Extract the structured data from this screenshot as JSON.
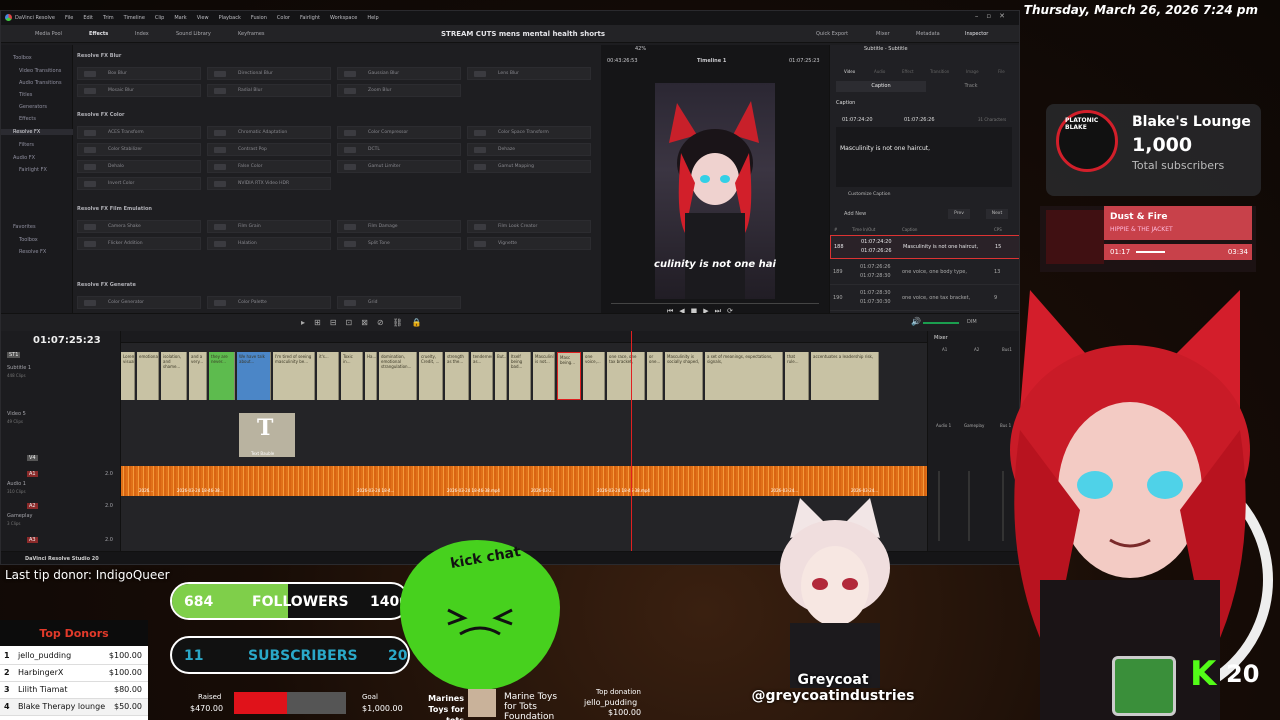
{
  "datetime": "Thursday, March 26, 2026 7:24 pm",
  "resolve": {
    "menu": [
      "DaVinci Resolve",
      "File",
      "Edit",
      "Trim",
      "Timeline",
      "Clip",
      "Mark",
      "View",
      "Playback",
      "Fusion",
      "Color",
      "Fairlight",
      "Workspace",
      "Help"
    ],
    "toolbar": {
      "media_pool": "Media Pool",
      "effects": "Effects",
      "index": "Index",
      "sound_library": "Sound Library",
      "keyframes": "Keyframes",
      "quick_export": "Quick Export",
      "mixer": "Mixer",
      "metadata": "Metadata",
      "inspector": "Inspector"
    },
    "project_title": "STREAM CUTS mens mental health shorts",
    "sidebar": [
      "Toolbox",
      "Video Transitions",
      "Audio Transitions",
      "Titles",
      "Generators",
      "Effects",
      "Resolve FX",
      "Filters",
      "Audio FX",
      "Fairlight FX",
      "Favorites",
      "Toolbox",
      "Resolve FX"
    ],
    "fx_groups": [
      {
        "name": "Resolve FX Blur",
        "items": [
          "Box Blur",
          "Directional Blur",
          "Gaussian Blur",
          "Lens Blur",
          "Mosaic Blur",
          "Radial Blur",
          "Zoom Blur"
        ]
      },
      {
        "name": "Resolve FX Color",
        "items": [
          "ACES Transform",
          "Chromatic Adaptation",
          "Color Compressor",
          "Color Space Transform",
          "Color Stabilizer",
          "Contrast Pop",
          "DCTL",
          "Dehaze",
          "Dehalo",
          "False Color",
          "Gamut Limiter",
          "Gamut Mapping",
          "Invert Color",
          "NVIDIA RTX Video HDR"
        ]
      },
      {
        "name": "Resolve FX Film Emulation",
        "items": [
          "Camera Shake",
          "Film Grain",
          "Film Damage",
          "Film Look Creator",
          "Flicker Addition",
          "Halation",
          "Split Tone",
          "Vignette"
        ]
      },
      {
        "name": "Resolve FX Generate",
        "items": [
          "Color Generator",
          "Color Palette",
          "Grid"
        ]
      }
    ],
    "viewer": {
      "zoom": "42%",
      "timeline_name": "Timeline 1",
      "timecode_left": "00:43:26:53",
      "timecode_right": "01:07:25:23",
      "caption": "culinity is not one hai"
    },
    "inspector": {
      "title": "Subtitle - Subtitle",
      "tabs": [
        "Video",
        "Audio",
        "Effect",
        "Transition",
        "Image",
        "File"
      ],
      "subtabs": [
        "Caption",
        "Track"
      ],
      "section": "Caption",
      "in": "01:07:24:20",
      "out": "01:07:26:26",
      "chars": "31 Characters",
      "text": "Masculinity is not one haircut,",
      "customize": "Customize Caption",
      "add_new": "Add New",
      "prev": "Prev",
      "next": "Next",
      "list_headers": [
        "#",
        "Time In/Out",
        "Caption",
        "CPS"
      ],
      "rows": [
        {
          "num": "188",
          "in": "01:07:24:20",
          "out": "01:07:26:26",
          "text": "Masculinity is not one haircut,",
          "cps": "15"
        },
        {
          "num": "189",
          "in": "01:07:26:26",
          "out": "01:07:28:30",
          "text": "one voice, one body type,",
          "cps": "13"
        },
        {
          "num": "190",
          "in": "01:07:28:30",
          "out": "01:07:30:30",
          "text": "one voice, one tax bracket,",
          "cps": "9"
        }
      ]
    },
    "timeline": {
      "timecode": "01:07:25:23",
      "tracks": [
        {
          "id": "ST1",
          "name": "Subtitle 1",
          "clips": "448 Clips"
        },
        {
          "id": "V5",
          "name": "Video 5",
          "clips": "49 Clips"
        },
        {
          "id": "V4",
          "name": "",
          "clips": ""
        },
        {
          "id": "A1",
          "name": "Audio 1",
          "clips": "310 Clips",
          "level": "2.0"
        },
        {
          "id": "A2",
          "name": "Gameplay",
          "clips": "3 Clips",
          "level": "2.0"
        },
        {
          "id": "A3",
          "name": "",
          "clips": "",
          "level": "2.0"
        }
      ],
      "subtitle_clips": [
        "Lorem visual...",
        "emotional...",
        "isolation, and shame...",
        "and a very...",
        "they are never...",
        "We have talk about...",
        "I'm tired of seeing masculinity be...",
        "it's...",
        "Toxic in...",
        "Ha...",
        "domination, emotional strangulation...",
        "cruelty, Credit, ...",
        "strength as the...",
        "tenderness as...",
        "But...",
        "Itself being bad...",
        "Masculinity is not...",
        "Masc being...",
        "one voice,...",
        "one race, one tax bracket,",
        "or one...",
        "Masculinity is socially shaped,",
        "a set of meanings, expectations, signals,",
        "that rule...",
        "accentuates a leadership risk,"
      ],
      "video_clip_label": "Text Bauble",
      "audio_clip_labels": [
        "2026...",
        "2026-03-24 18-46-38...",
        "2026-03-24 18-4...",
        "2026-03-24 18-46-38.mp4",
        "2026-03-2...",
        "2026-03-24 18-46-38.mp4",
        "2026-03-24...",
        "2026-03-24..."
      ]
    },
    "mixer": {
      "title": "Mixer",
      "channels": [
        "A1",
        "A2",
        "Bus1"
      ],
      "labels": [
        "Audio 1",
        "Gameplay",
        "Bus 1"
      ]
    },
    "status": "DaVinci Resolve Studio 20",
    "volume_label": "DIM"
  },
  "subs_card": {
    "name": "Blake's Lounge",
    "count": "1,000",
    "label": "Total subscribers",
    "logo_text": "PLATONIC BLAKE"
  },
  "music": {
    "title": "Dust & Fire",
    "artist": "HIPPIE & THE JACKET",
    "elapsed": "01:17",
    "total": "03:34",
    "progress": 0.36
  },
  "last_tip": "Last tip donor: IndigoQueer",
  "goals": [
    {
      "current": "684",
      "label": "FOLLOWERS",
      "target": "1400",
      "fraction": 0.49,
      "color": "#7fcf4a"
    },
    {
      "current": "11",
      "label": "SUBSCRIBERS",
      "target": "20",
      "fraction": 0.55,
      "color": "#2aa8c8"
    }
  ],
  "top_donors": {
    "title": "Top Donors",
    "rows": [
      {
        "rank": "1",
        "name": "jello_pudding",
        "amount": "$100.00"
      },
      {
        "rank": "2",
        "name": "HarbingerX",
        "amount": "$100.00"
      },
      {
        "rank": "3",
        "name": "Lilith Tiamat",
        "amount": "$80.00"
      },
      {
        "rank": "4",
        "name": "Blake Therapy lounge",
        "amount": "$50.00"
      }
    ]
  },
  "fundraiser": {
    "raised_label": "Raised",
    "raised": "$470.00",
    "goal_label": "Goal",
    "goal": "$1,000.00",
    "fraction": 0.47,
    "org_short": "Marines Toys for tots",
    "org_long": "Marine Toys for Tots Foundation",
    "top_label": "Top donation",
    "top_name": "jello_pudding",
    "top_amount": "$100.00"
  },
  "kick_chat": "kick chat",
  "greycoat": {
    "name": "Greycoat",
    "handle": "@greycoatindustries"
  },
  "kick_count": "20",
  "colors": {
    "accent_red": "#d32f2f",
    "kick_green": "#53fc18",
    "audio_orange": "#e57518",
    "subtitle_clip": "#c8c2a4"
  }
}
